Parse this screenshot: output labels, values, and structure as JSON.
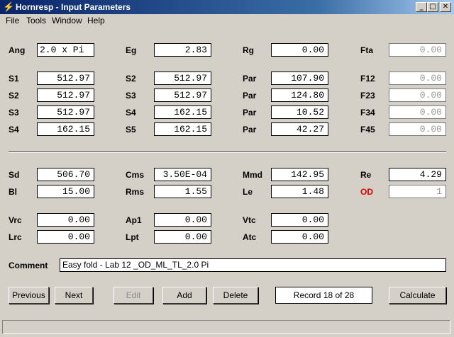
{
  "window": {
    "title": "Hornresp - Input Parameters",
    "app_icon": "lightning-icon",
    "minimize_glyph": "_",
    "maximize_glyph": "□",
    "close_glyph": "✕"
  },
  "menu": {
    "file": "File",
    "tools": "Tools",
    "window": "Window",
    "help": "Help"
  },
  "params": {
    "ang": {
      "label": "Ang",
      "value": "2.0 x Pi"
    },
    "eg": {
      "label": "Eg",
      "value": "2.83"
    },
    "rg": {
      "label": "Rg",
      "value": "0.00"
    },
    "fta": {
      "label": "Fta",
      "value": "0.00"
    },
    "s1a": {
      "label": "S1",
      "value": "512.97"
    },
    "s2a": {
      "label": "S2",
      "value": "512.97"
    },
    "s3a": {
      "label": "S3",
      "value": "512.97"
    },
    "s4a": {
      "label": "S4",
      "value": "162.15"
    },
    "s2b": {
      "label": "S2",
      "value": "512.97"
    },
    "s3b": {
      "label": "S3",
      "value": "512.97"
    },
    "s4b": {
      "label": "S4",
      "value": "162.15"
    },
    "s5b": {
      "label": "S5",
      "value": "162.15"
    },
    "par1": {
      "label": "Par",
      "value": "107.90"
    },
    "par2": {
      "label": "Par",
      "value": "124.80"
    },
    "par3": {
      "label": "Par",
      "value": "10.52"
    },
    "par4": {
      "label": "Par",
      "value": "42.27"
    },
    "f12": {
      "label": "F12",
      "value": "0.00"
    },
    "f23": {
      "label": "F23",
      "value": "0.00"
    },
    "f34": {
      "label": "F34",
      "value": "0.00"
    },
    "f45": {
      "label": "F45",
      "value": "0.00"
    },
    "sd": {
      "label": "Sd",
      "value": "506.70"
    },
    "bl": {
      "label": "Bl",
      "value": "15.00"
    },
    "cms": {
      "label": "Cms",
      "value": "3.50E-04"
    },
    "rms": {
      "label": "Rms",
      "value": "1.55"
    },
    "mmd": {
      "label": "Mmd",
      "value": "142.95"
    },
    "le": {
      "label": "Le",
      "value": "1.48"
    },
    "re": {
      "label": "Re",
      "value": "4.29"
    },
    "od": {
      "label": "OD",
      "value": "1"
    },
    "vrc": {
      "label": "Vrc",
      "value": "0.00"
    },
    "lrc": {
      "label": "Lrc",
      "value": "0.00"
    },
    "ap1": {
      "label": "Ap1",
      "value": "0.00"
    },
    "lpt": {
      "label": "Lpt",
      "value": "0.00"
    },
    "vtc": {
      "label": "Vtc",
      "value": "0.00"
    },
    "atc": {
      "label": "Atc",
      "value": "0.00"
    }
  },
  "comment": {
    "label": "Comment",
    "value": "Easy fold  - Lab 12 _OD_ML_TL_2.0 Pi"
  },
  "buttons": {
    "previous": "Previous",
    "next": "Next",
    "edit": "Edit",
    "add": "Add",
    "delete": "Delete",
    "calculate": "Calculate"
  },
  "record": "Record 18 of 28",
  "status": ""
}
